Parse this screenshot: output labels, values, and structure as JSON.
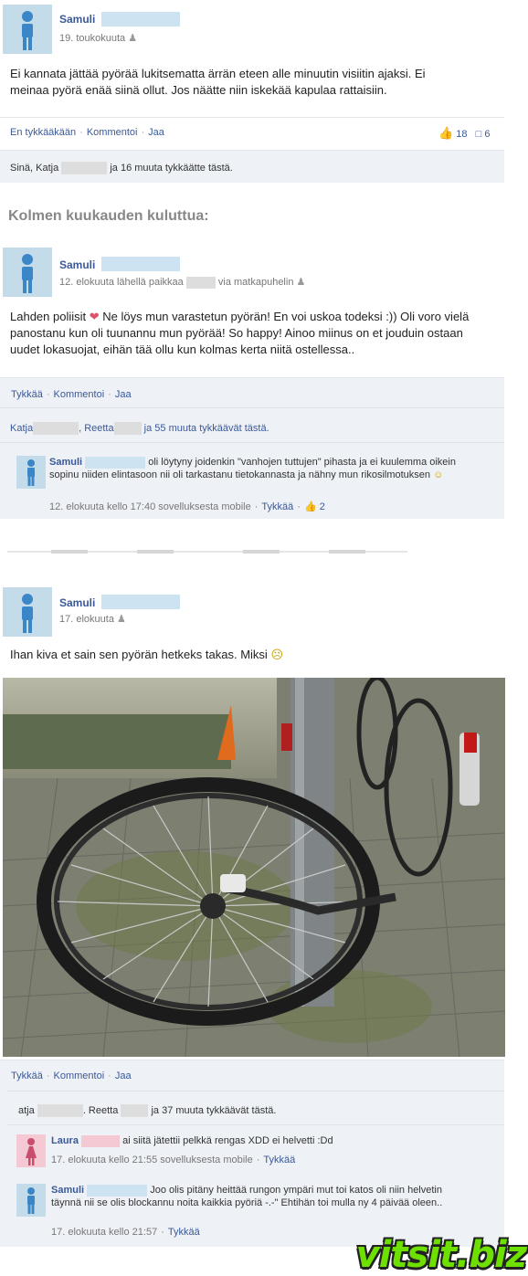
{
  "post1": {
    "author": "Samuli",
    "date": "19. toukokuuta",
    "text": "Ei kannata jättää pyörää lukitsematta ärrän eteen alle minuutin visiitin ajaksi. Ei meinaa pyörä enää siinä ollut. Jos näätte niin iskekää kapulaa rattaisiin.",
    "actions": [
      "En tykkääkään",
      "Kommentoi",
      "Jaa"
    ],
    "like_count": "18",
    "comment_count": "6",
    "likes_prefix": "Sinä, Katja",
    "likes_suffix": "ja 16 muuta tykkäätte tästä."
  },
  "heading": "Kolmen kuukauden kuluttua:",
  "post2": {
    "author": "Samuli",
    "date": "12. elokuuta lähellä paikkaa",
    "via": "via matkapuhelin",
    "text_a": "Lahden poliisit",
    "text_b": "Ne löys mun varastetun pyörän! En voi uskoa todeksi :)) Oli voro vielä panostanu kun oli tuunannu mun pyörää! So happy! Ainoo miinus on et jouduin ostaan uudet lokasuojat, eihän tää ollu kun kolmas kerta niitä ostellessa..",
    "actions": [
      "Tykkää",
      "Kommentoi",
      "Jaa"
    ],
    "likes_a": "Katja",
    "likes_b": ", Reetta",
    "likes_c": "ja 55 muuta tykkäävät tästä.",
    "comment": {
      "author": "Samuli",
      "text": "oli löytyny joidenkin \"vanhojen tuttujen\" pihasta ja ei kuulemma oikein sopinu niiden elintasoon nii oli tarkastanu tietokannasta ja nähny mun rikosilmotuksen",
      "meta": "12. elokuuta kello 17:40 sovelluksesta mobile",
      "like": "Tykkää",
      "like_count": "2"
    }
  },
  "post3": {
    "author": "Samuli",
    "date": "17. elokuuta",
    "text": "Ihan kiva et sain sen pyörän hetkeks takas. Miksi",
    "actions": [
      "Tykkää",
      "Kommentoi",
      "Jaa"
    ],
    "likes_a": "atja",
    "likes_b": ". Reetta",
    "likes_c": "ja 37 muuta tykkäävät tästä.",
    "comment1": {
      "author": "Laura",
      "text": "ai siitä jätettii pelkkä rengas XDD ei helvetti :Dd",
      "meta": "17. elokuuta kello 21:55 sovelluksesta mobile",
      "like": "Tykkää"
    },
    "comment2": {
      "author": "Samuli",
      "text": "Joo olis pitäny heittää rungon ympäri mut toi katos oli niin helvetin täynnä nii se olis blockannu noita kaikkia pyöriä -.-\" Ehtihän toi mulla ny 4 päivää oleen..",
      "meta": "17. elokuuta kello 21:57",
      "like": "Tykkää"
    }
  },
  "watermark": "vitsit.biz",
  "colors": {
    "link": "#3b5998",
    "avatar": "#c4dcea",
    "female_avatar": "#f4c9d4",
    "green": "#6ee000"
  }
}
